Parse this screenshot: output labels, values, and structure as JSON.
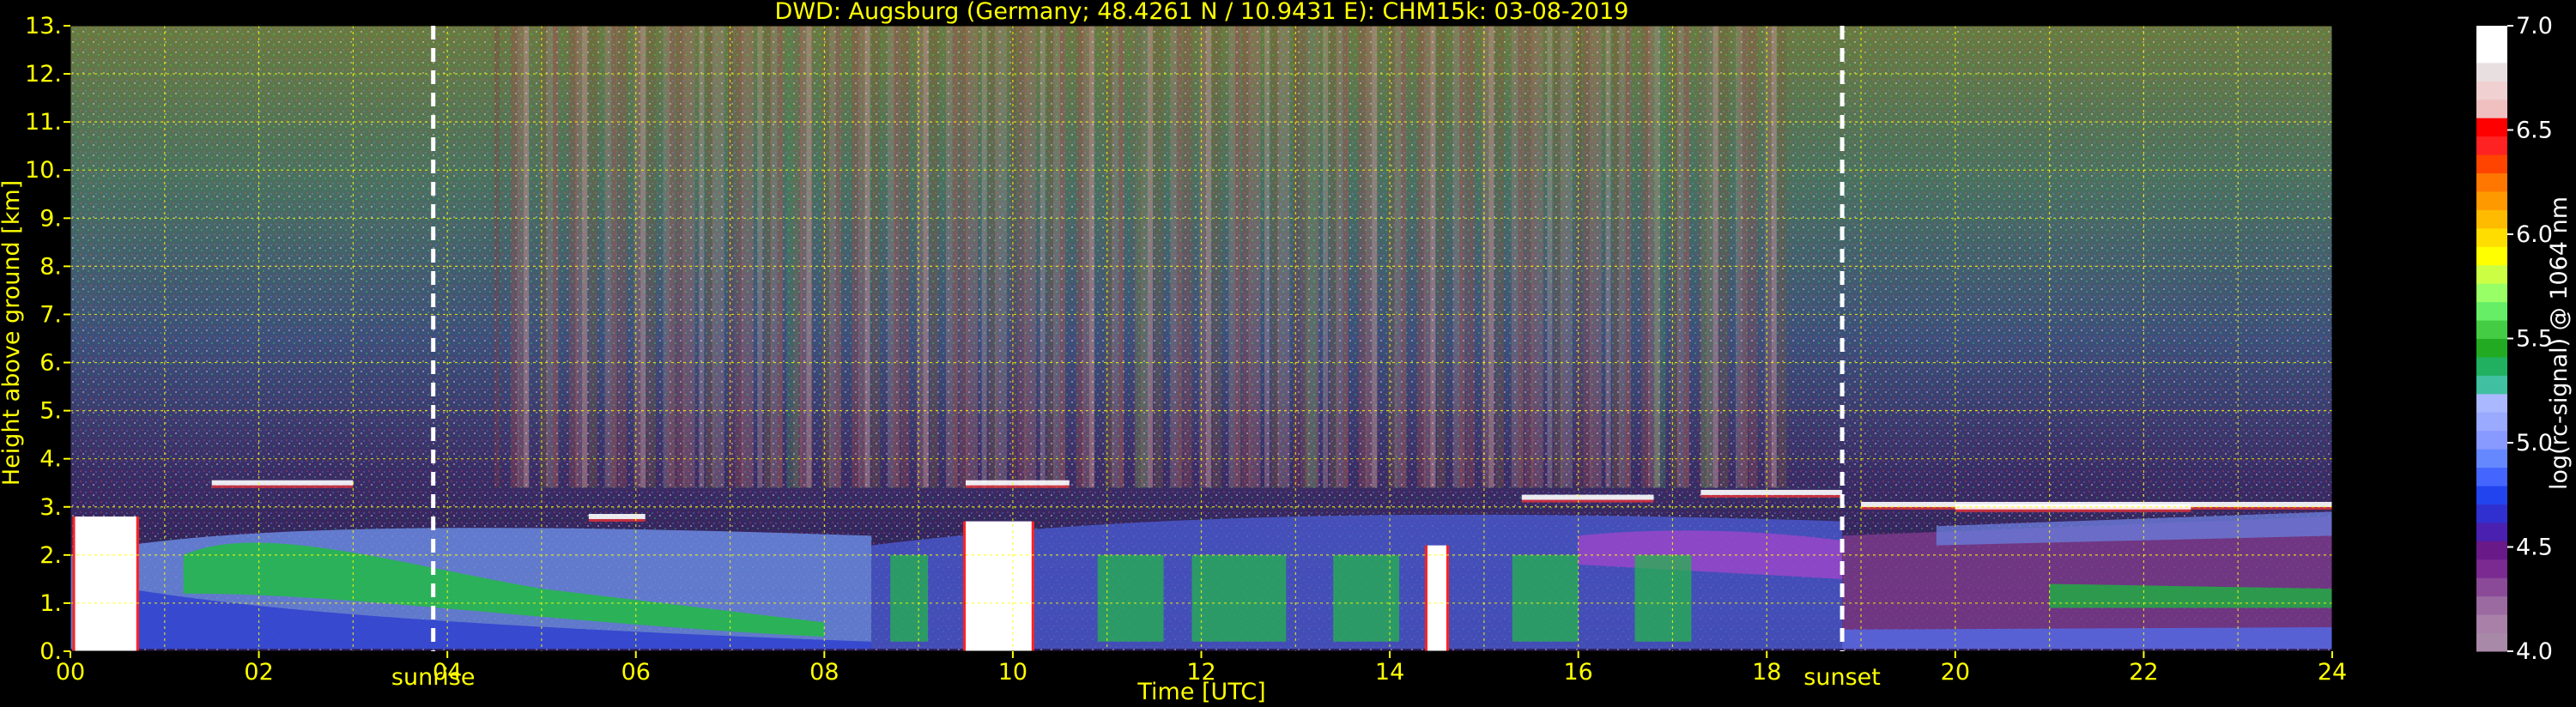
{
  "chart_data": {
    "type": "heatmap",
    "title": "DWD: Augsburg (Germany; 48.4261 N / 10.9431 E):    CHM15k: 03-08-2019",
    "xlabel": "Time [UTC]",
    "ylabel": "Height above ground [km]",
    "xlim": [
      0,
      24
    ],
    "ylim": [
      0,
      13
    ],
    "x_ticks": [
      "00",
      "02",
      "04",
      "06",
      "08",
      "10",
      "12",
      "14",
      "16",
      "18",
      "20",
      "22",
      "24"
    ],
    "y_ticks": [
      "0.",
      "1.",
      "2.",
      "3.",
      "4.",
      "5.",
      "6.",
      "7.",
      "8.",
      "9.",
      "10.",
      "11.",
      "12.",
      "13."
    ],
    "grid": true,
    "annotations": [
      {
        "label": "sunrise",
        "x": 3.85
      },
      {
        "label": "sunset",
        "x": 18.8
      }
    ],
    "colorbar": {
      "label": "log(rc-signal) @ 1064 nm",
      "range": [
        4.0,
        7.0
      ],
      "ticks": [
        "4.0",
        "4.5",
        "5.0",
        "5.5",
        "6.0",
        "6.5",
        "7.0"
      ]
    }
  },
  "colors": {
    "text": "#FFFF00",
    "grid": "#FFFF00",
    "background": "#000000"
  }
}
